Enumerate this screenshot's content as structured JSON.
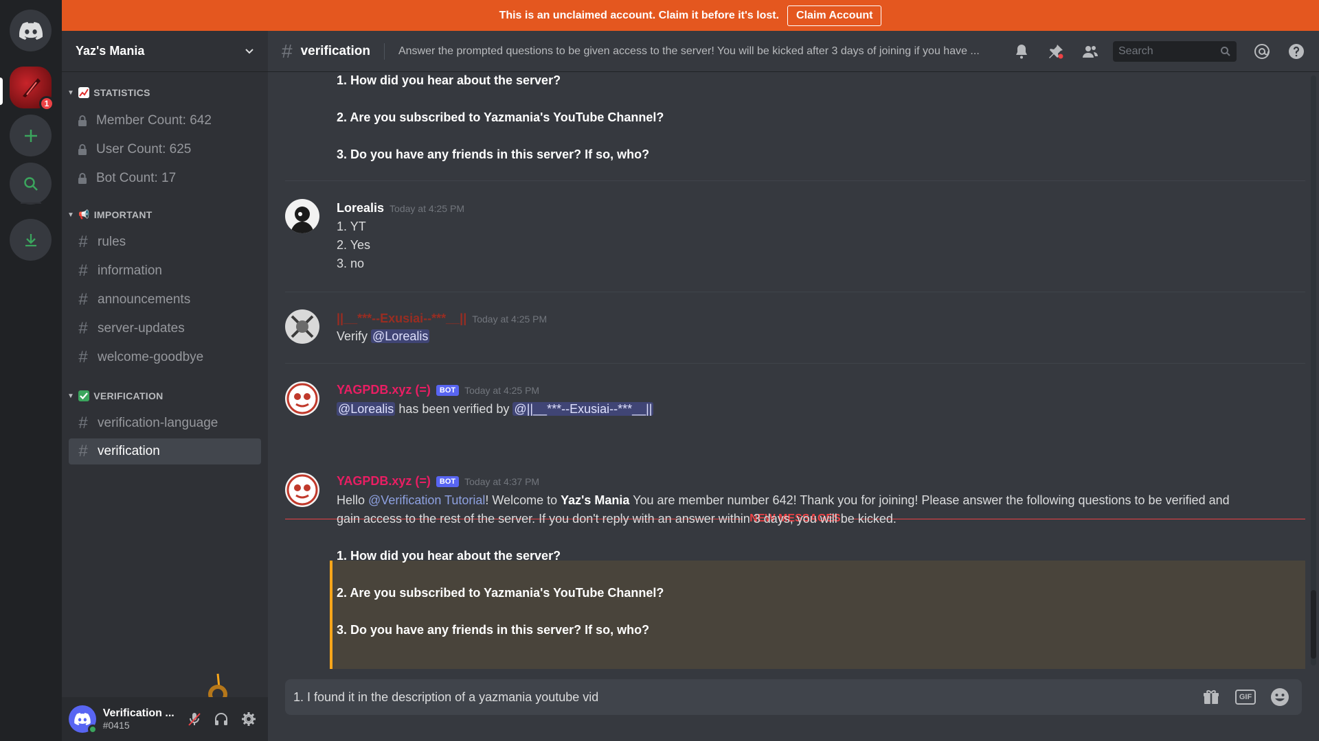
{
  "banner": {
    "text": "This is an unclaimed account. Claim it before it's lost.",
    "button": "Claim Account"
  },
  "rail": {
    "server_badge": "1"
  },
  "guild": {
    "name": "Yaz's Mania"
  },
  "categories": {
    "statistics": "STATISTICS",
    "important": "IMPORTANT",
    "verification": "VERIFICATION"
  },
  "channels": {
    "member_count": "Member Count: 642",
    "user_count": "User Count: 625",
    "bot_count": "Bot Count: 17",
    "rules": "rules",
    "information": "information",
    "announcements": "announcements",
    "server_updates": "server-updates",
    "welcome_goodbye": "welcome-goodbye",
    "verification_language": "verification-language",
    "verification": "verification"
  },
  "user": {
    "name": "Verification ...",
    "tag": "#0415"
  },
  "header": {
    "channel": "verification",
    "topic": "Answer the prompted questions to be given access to the server! You will be kicked after 3 days of joining if you have ...",
    "search_placeholder": "Search"
  },
  "messages": {
    "top_q1": "1. How did you hear about the server?",
    "top_q2": "2. Are you subscribed to Yazmania's YouTube Channel?",
    "top_q3": "3. Do you have any friends in this server? If so, who?",
    "m1": {
      "author": "Lorealis",
      "time": "Today at 4:25 PM",
      "l1": "1. YT",
      "l2": "2. Yes",
      "l3": "3. no"
    },
    "m2": {
      "author": "||__***--Exusiai--***__||",
      "time": "Today at 4:25 PM",
      "text": "Verify ",
      "mention": "@Lorealis"
    },
    "m3": {
      "author": "YAGPDB.xyz (=)",
      "bot": "BOT",
      "time": "Today at 4:25 PM",
      "mention1": "@Lorealis",
      "mid": " has been verified by ",
      "mention2": "@||__***--Exusiai--***__||"
    },
    "new_messages": "NEW MESSAGES",
    "m4": {
      "author": "YAGPDB.xyz (=)",
      "bot": "BOT",
      "time": "Today at 4:37 PM",
      "hello": "Hello ",
      "mention": "@Verification Tutorial",
      "welcome": "! Welcome to ",
      "server": "Yaz's Mania",
      "rest1": " You are member number 642! Thank you for joining! Please answer the following questions to be verified and",
      "rest2": "gain access to the rest of the server. If you don't reply with an answer within 3 days, you will be kicked.",
      "q1": "1. How did you hear about the server?",
      "q2": "2. Are you subscribed to Yazmania's YouTube Channel?",
      "q3": "3. Do you have any friends in this server? If so, who?"
    }
  },
  "composer": {
    "value": "1. I found it in the description of a yazmania youtube vid",
    "gif": "GIF"
  },
  "colors": {
    "banner": "#e4571f",
    "bot_name": "#e91e63",
    "exusiai_name": "#992d22",
    "highlight": "#faa61a"
  }
}
